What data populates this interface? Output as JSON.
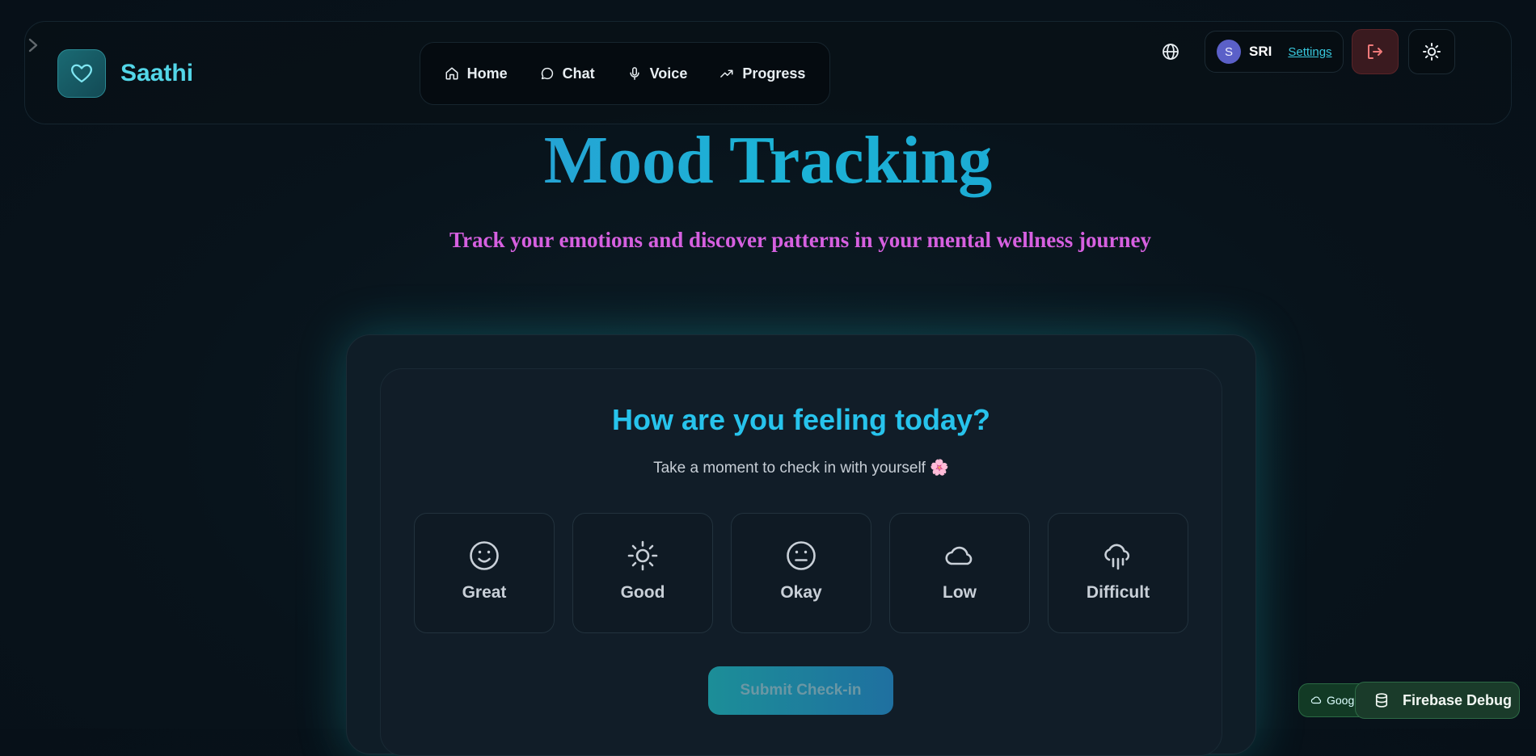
{
  "brand": {
    "name": "Saathi"
  },
  "nav": {
    "items": [
      {
        "label": "Home",
        "icon": "home-icon"
      },
      {
        "label": "Chat",
        "icon": "chat-icon"
      },
      {
        "label": "Voice",
        "icon": "mic-icon"
      },
      {
        "label": "Progress",
        "icon": "trending-icon"
      }
    ]
  },
  "user": {
    "initial": "S",
    "name": "SRI",
    "settings_label": "Settings"
  },
  "page": {
    "title": "Mood Tracking",
    "subtitle": "Track your emotions and discover patterns in your mental wellness journey"
  },
  "checkin": {
    "question": "How are you feeling today?",
    "hint": "Take a moment to check in with yourself 🌸",
    "moods": [
      {
        "label": "Great",
        "icon": "smile-icon"
      },
      {
        "label": "Good",
        "icon": "sun-icon"
      },
      {
        "label": "Okay",
        "icon": "meh-icon"
      },
      {
        "label": "Low",
        "icon": "cloud-icon"
      },
      {
        "label": "Difficult",
        "icon": "rain-cloud-icon"
      }
    ],
    "submit_label": "Submit Check-in"
  },
  "debug": {
    "google_label": "Goog",
    "firebase_label": "Firebase Debug"
  },
  "colors": {
    "accent": "#27c3ec",
    "brand": "#53d6e8",
    "subtitle": "#d660e0",
    "background": "#08131b"
  }
}
